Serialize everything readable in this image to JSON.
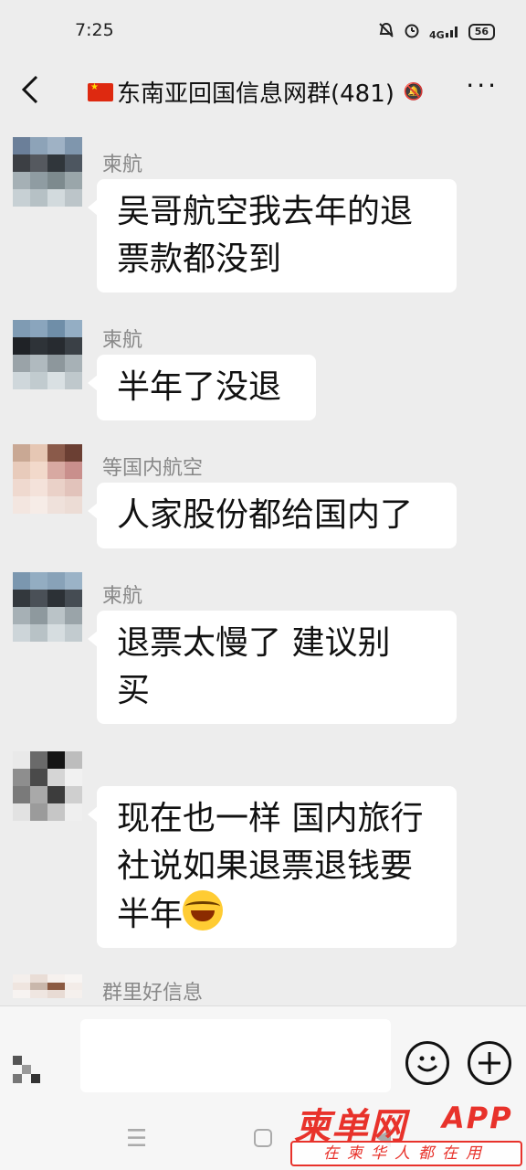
{
  "status_bar": {
    "time": "7:25",
    "network": "4G",
    "battery": "56"
  },
  "header": {
    "title": "东南亚回国信息网群(481)",
    "back_icon": "chevron-left-icon",
    "more_icon": "more-dots-icon"
  },
  "messages": [
    {
      "sender": "柬航",
      "lines": [
        "吴哥航空我去年的退",
        "票款都没到"
      ],
      "avatar_colors": [
        "#6b7f99",
        "#8da3b8",
        "#9fb2c5",
        "#7f96ad",
        "#3c3f44",
        "#55595f",
        "#30363b",
        "#4d5660",
        "#a5b0b5",
        "#8f9ca2",
        "#7d8a8e",
        "#9aa6aa",
        "#c7d0d4",
        "#b6c1c5",
        "#d2dadd",
        "#bcc5c9"
      ]
    },
    {
      "sender": "柬航",
      "lines": [
        "半年了没退"
      ],
      "avatar_colors": [
        "#7f9bb3",
        "#8aa5bd",
        "#6f8ea8",
        "#94aec4",
        "#1f2226",
        "#2e3338",
        "#272b30",
        "#3a4046",
        "#9aa3a8",
        "#b0babf",
        "#8d979c",
        "#a7b1b6",
        "#cfd7db",
        "#c1cbcf",
        "#d9e0e3",
        "#bfc8cc"
      ]
    },
    {
      "sender": "等国内航空",
      "lines": [
        "人家股份都给国内了"
      ],
      "avatar_colors": [
        "#c9a894",
        "#e6c7b4",
        "#8a5a4a",
        "#6b3f33",
        "#e8cbbb",
        "#f2d9cb",
        "#d8a9a2",
        "#c98f8c",
        "#efd9cf",
        "#f4e2da",
        "#ead1c8",
        "#e2c3bb",
        "#f3e6e0",
        "#f6ece7",
        "#efe1db",
        "#ecdcd5"
      ]
    },
    {
      "sender": "柬航",
      "lines": [
        "退票太慢了  建议别",
        "买"
      ],
      "avatar_colors": [
        "#7b97af",
        "#93adc2",
        "#88a2b8",
        "#9bb3c7",
        "#33383d",
        "#4a5057",
        "#2c3136",
        "#454c53",
        "#a6b0b5",
        "#8e999e",
        "#bac3c7",
        "#9aa4a9",
        "#cdd5d9",
        "#b8c2c6",
        "#d6dde0",
        "#c2cbcf"
      ]
    },
    {
      "sender": "",
      "lines": [
        "现在也一样 国内旅行",
        "社说如果退票退钱要",
        "半年"
      ],
      "has_emoji": true,
      "emoji_icon": "laughing-tears-emoji-icon",
      "avatar_colors": [
        "#e9e9e9",
        "#6a6a6a",
        "#151515",
        "#bdbdbd",
        "#8e8e8e",
        "#4a4a4a",
        "#d5d5d5",
        "#f1f1f1",
        "#7a7a7a",
        "#a9a9a9",
        "#3c3c3c",
        "#cfcfcf",
        "#e2e2e2",
        "#9b9b9b",
        "#c6c6c6",
        "#efefef"
      ]
    },
    {
      "sender": "群里好信息",
      "lines": [],
      "avatar_colors": [
        "#f4efec",
        "#e9ddd6",
        "#f6f1ee",
        "#f8f5f3",
        "#efe5df",
        "#c9b7ab",
        "#8b5a42",
        "#f3ece8",
        "#f7f3f1",
        "#efe6e1",
        "#e8dbd4",
        "#f5f0ed",
        "#ededed",
        "#ededed",
        "#ededed",
        "#ededed"
      ]
    }
  ],
  "input": {
    "placeholder": "",
    "voice_icon": "voice-icon",
    "emoji_icon": "emoji-face-icon",
    "plus_icon": "plus-icon"
  },
  "watermark": {
    "logo": "柬单网",
    "app": "APP",
    "slogan": "在柬华人都在用"
  }
}
